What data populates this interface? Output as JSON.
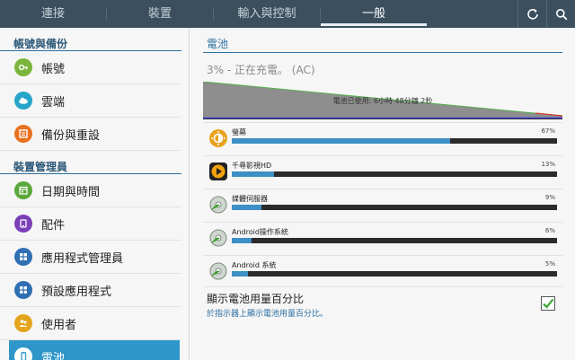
{
  "tabs": [
    {
      "label": "連接"
    },
    {
      "label": "裝置"
    },
    {
      "label": "輸入與控制"
    },
    {
      "label": "一般"
    }
  ],
  "top_icons": [
    "refresh-icon",
    "search-icon"
  ],
  "sidebar": {
    "sections": [
      {
        "heading": "帳號與備份",
        "items": [
          {
            "label": "帳號",
            "icon": "key-icon",
            "color": "#7cb53c"
          },
          {
            "label": "雲端",
            "icon": "cloud-icon",
            "color": "#27a5c8"
          },
          {
            "label": "備份與重設",
            "icon": "backup-icon",
            "color": "#e8701e"
          }
        ]
      },
      {
        "heading": "裝置管理員",
        "items": [
          {
            "label": "日期與時間",
            "icon": "calendar-icon",
            "color": "#5aa83a"
          },
          {
            "label": "配件",
            "icon": "accessory-icon",
            "color": "#7b3fb8"
          },
          {
            "label": "應用程式管理員",
            "icon": "apps-grid-icon",
            "color": "#2f6fb3"
          },
          {
            "label": "預設應用程式",
            "icon": "default-apps-icon",
            "color": "#2f6fb3"
          },
          {
            "label": "使用者",
            "icon": "users-icon",
            "color": "#e3a51c"
          },
          {
            "label": "電池",
            "icon": "battery-icon",
            "color": "#ffffff",
            "active": true
          }
        ]
      }
    ]
  },
  "main": {
    "title": "電池",
    "status": "3% - 正在充電。 (AC)",
    "graph_label": "電池已使用: 6小時 48分鐘 2秒",
    "apps": [
      {
        "name": "螢幕",
        "percent": "67%",
        "value": 0.67,
        "icon": "brightness-icon"
      },
      {
        "name": "千尋影視HD",
        "percent": "13%",
        "value": 0.13,
        "icon": "video-player-icon"
      },
      {
        "name": "媒體伺服器",
        "percent": "9%",
        "value": 0.09,
        "icon": "android-system-icon"
      },
      {
        "name": "Android操作系統",
        "percent": "6%",
        "value": 0.06,
        "icon": "android-system-icon"
      },
      {
        "name": "Android 系統",
        "percent": "5%",
        "value": 0.05,
        "icon": "android-system-icon"
      }
    ],
    "show_percent": {
      "title": "顯示電池用量百分比",
      "subtitle": "於指示器上顯示電池用量百分比。",
      "checked": true
    }
  }
}
